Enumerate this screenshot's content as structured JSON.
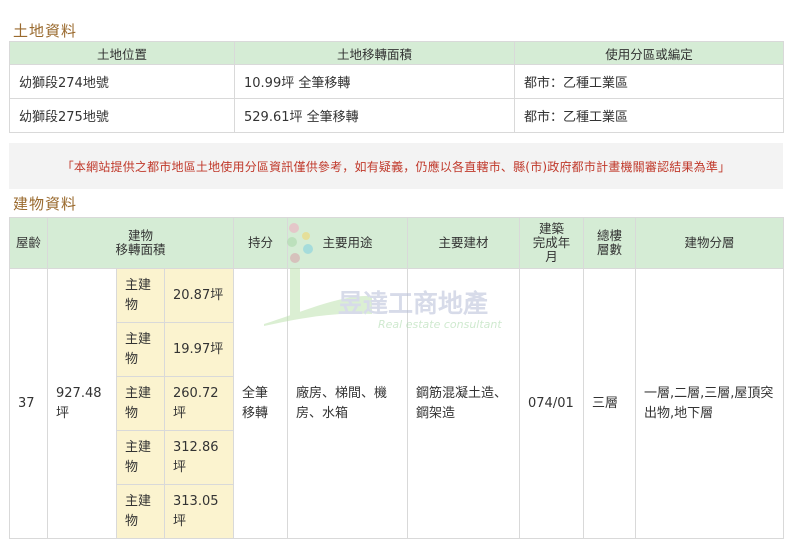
{
  "land": {
    "title": "土地資料",
    "headers": [
      "土地位置",
      "土地移轉面積",
      "使用分區或編定"
    ],
    "rows": [
      [
        "幼獅段274地號",
        "10.99坪 全筆移轉",
        "都市：乙種工業區"
      ],
      [
        "幼獅段275地號",
        "529.61坪 全筆移轉",
        "都市：乙種工業區"
      ]
    ]
  },
  "notice": "「本網站提供之都市地區土地使用分區資訊僅供參考，如有疑義，仍應以各直轄市、縣(市)政府都市計畫機關審認結果為準」",
  "building": {
    "title": "建物資料",
    "headers": {
      "age": "屋齡",
      "area": "建物\n移轉面積",
      "share": "持分",
      "use": "主要用途",
      "material": "主要建材",
      "completed": "建築\n完成年\n月",
      "floors": "總樓\n層數",
      "levels": "建物分層"
    },
    "row": {
      "age": "37",
      "area": "927.48坪",
      "share": "全筆移轉",
      "use": "廠房、梯間、機房、水箱",
      "material": "鋼筋混凝土造、鋼架造",
      "completed": "074/01",
      "floors": "三層",
      "levels": "一層,二層,三層,屋頂突出物,地下層"
    },
    "sub_items": [
      {
        "label": "主建物",
        "area": "20.87坪"
      },
      {
        "label": "主建物",
        "area": "19.97坪"
      },
      {
        "label": "主建物",
        "area": "260.72坪"
      },
      {
        "label": "主建物",
        "area": "312.86坪"
      },
      {
        "label": "主建物",
        "area": "313.05坪"
      }
    ]
  },
  "watermark": {
    "brand": "昱達工商地產",
    "slogan": "Real estate consultant",
    "colors": [
      "#f2a9c0",
      "#a8d8a8",
      "#f3d56b",
      "#7fcfe0",
      "#d8a0a8",
      "#bfe2b0"
    ]
  }
}
